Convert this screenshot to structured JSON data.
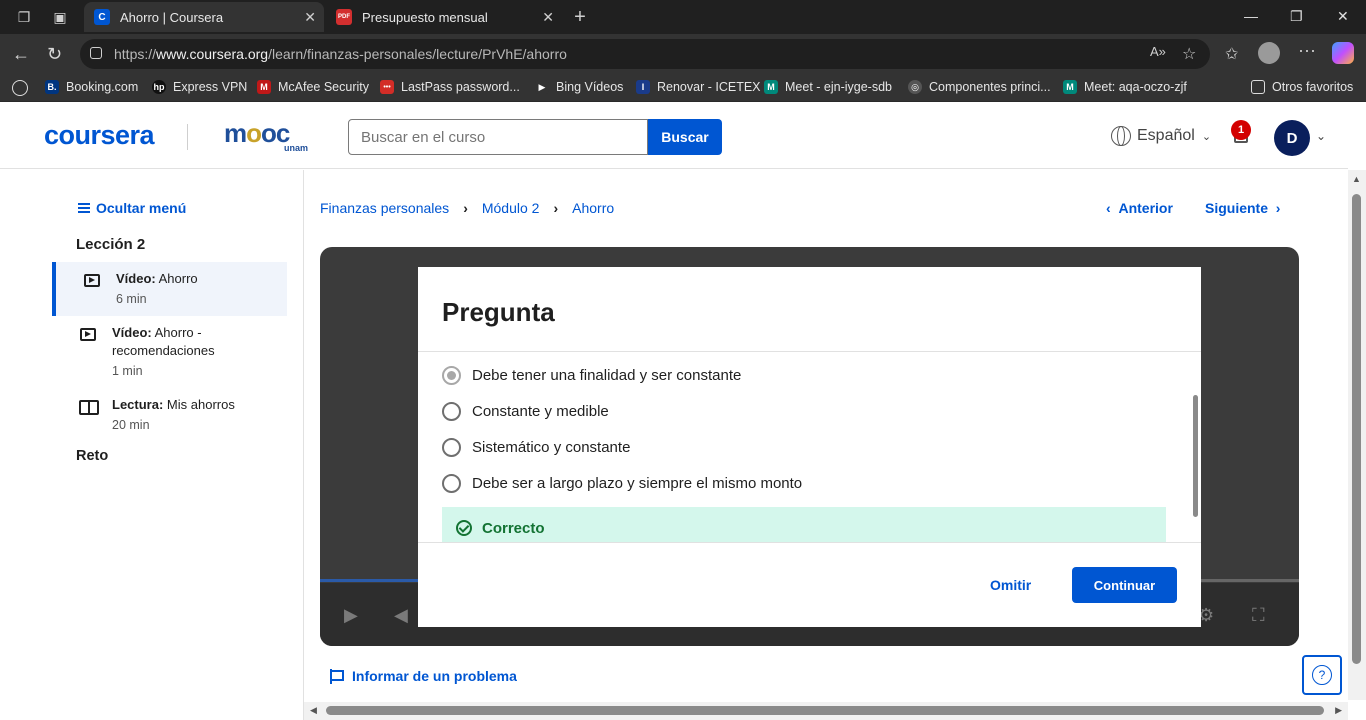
{
  "browser": {
    "tabs": [
      {
        "title": "Ahorro | Coursera",
        "favicon_letter": "C",
        "favicon_color": "#0056d2",
        "active": true
      },
      {
        "title": "Presupuesto mensual",
        "favicon_letter": "PDF",
        "favicon_color": "#d32f2f",
        "active": false
      }
    ],
    "url_prefix": "https://",
    "url_host": "www.coursera.org",
    "url_path": "/learn/finanzas-personales/lecture/PrVhE/ahorro",
    "reader_label": "A»",
    "bookmarks": [
      {
        "label": "Booking.com",
        "icon_text": "B.",
        "icon_color": "#003580"
      },
      {
        "label": "Express VPN",
        "icon_text": "hp",
        "icon_color": "#111111"
      },
      {
        "label": "McAfee Security",
        "icon_text": "M",
        "icon_color": "#c01818"
      },
      {
        "label": "LastPass password...",
        "icon_text": "•••",
        "icon_color": "#d32d27"
      },
      {
        "label": "Bing Vídeos",
        "icon_text": "▶",
        "icon_color": "#333333"
      },
      {
        "label": "Renovar - ICETEX",
        "icon_text": "I",
        "icon_color": "#1a3b8a"
      },
      {
        "label": "Meet - ejn-iyge-sdb",
        "icon_text": "M",
        "icon_color": "#00897b"
      },
      {
        "label": "Componentes princi...",
        "icon_text": "◎",
        "icon_color": "#555555"
      },
      {
        "label": "Meet: aqa-oczo-zjf",
        "icon_text": "M",
        "icon_color": "#00897b"
      }
    ],
    "other_favorites": "Otros favoritos"
  },
  "header": {
    "brand": "coursera",
    "partner_logo": "mooc",
    "partner_sub": "unam",
    "search_placeholder": "Buscar en el curso",
    "search_button": "Buscar",
    "language": "Español",
    "notifications_count": "1",
    "avatar_initial": "D"
  },
  "sidebar": {
    "hide_menu": "Ocultar menú",
    "lesson_title": "Lección 2",
    "items": [
      {
        "type_label": "Vídeo:",
        "title": "Ahorro",
        "duration": "6 min",
        "active": true
      },
      {
        "type_label": "Vídeo:",
        "title": "Ahorro - recomendaciones",
        "duration": "1 min",
        "active": false
      },
      {
        "type_label": "Lectura:",
        "title": "Mis ahorros",
        "duration": "20 min",
        "active": false
      }
    ],
    "challenge": "Reto"
  },
  "main": {
    "breadcrumbs": [
      "Finanzas personales",
      "Módulo 2",
      "Ahorro"
    ],
    "prev": "Anterior",
    "next": "Siguiente",
    "report": "Informar de un problema"
  },
  "quiz": {
    "title": "Pregunta",
    "options": [
      {
        "label": "Debe tener una finalidad y ser constante",
        "selected": true
      },
      {
        "label": "Constante y medible",
        "selected": false
      },
      {
        "label": "Sistemático y constante",
        "selected": false
      },
      {
        "label": "Debe ser a largo plazo y siempre el mismo monto",
        "selected": false
      }
    ],
    "feedback": "Correcto",
    "skip": "Omitir",
    "continue": "Continuar"
  },
  "colors": {
    "accent": "#0056d2",
    "success": "#137333",
    "success_bg": "#d4f7ec",
    "badge": "#d30000"
  }
}
